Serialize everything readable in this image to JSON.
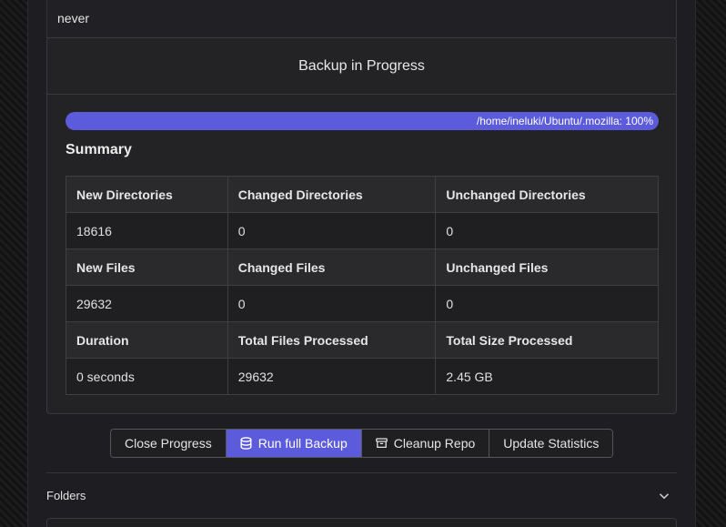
{
  "top_row": {
    "value": "never"
  },
  "modal": {
    "title": "Backup in Progress",
    "progress": {
      "label": "/home/ineluki/Ubuntu/.mozilla: 100%",
      "percent": 100,
      "color": "#5b5bdb"
    },
    "summary_title": "Summary",
    "table": [
      {
        "headers": [
          "New Directories",
          "Changed Directories",
          "Unchanged Directories"
        ],
        "values": [
          "18616",
          "0",
          "0"
        ]
      },
      {
        "headers": [
          "New Files",
          "Changed Files",
          "Unchanged Files"
        ],
        "values": [
          "29632",
          "0",
          "0"
        ]
      },
      {
        "headers": [
          "Duration",
          "Total Files Processed",
          "Total Size Processed"
        ],
        "values": [
          "0 seconds",
          "29632",
          "2.45 GB"
        ]
      }
    ]
  },
  "actions": {
    "close_progress": "Close Progress",
    "run_full_backup": "Run full Backup",
    "run_full_backup_icon": "database-icon",
    "cleanup_repo": "Cleanup Repo",
    "cleanup_repo_icon": "archive-icon",
    "update_statistics": "Update Statistics"
  },
  "folders": {
    "label": "Folders",
    "icon": "chevron-down-icon"
  },
  "colors": {
    "accent": "#5b5bdb",
    "surface": "#232326",
    "border": "#3f3f43"
  }
}
